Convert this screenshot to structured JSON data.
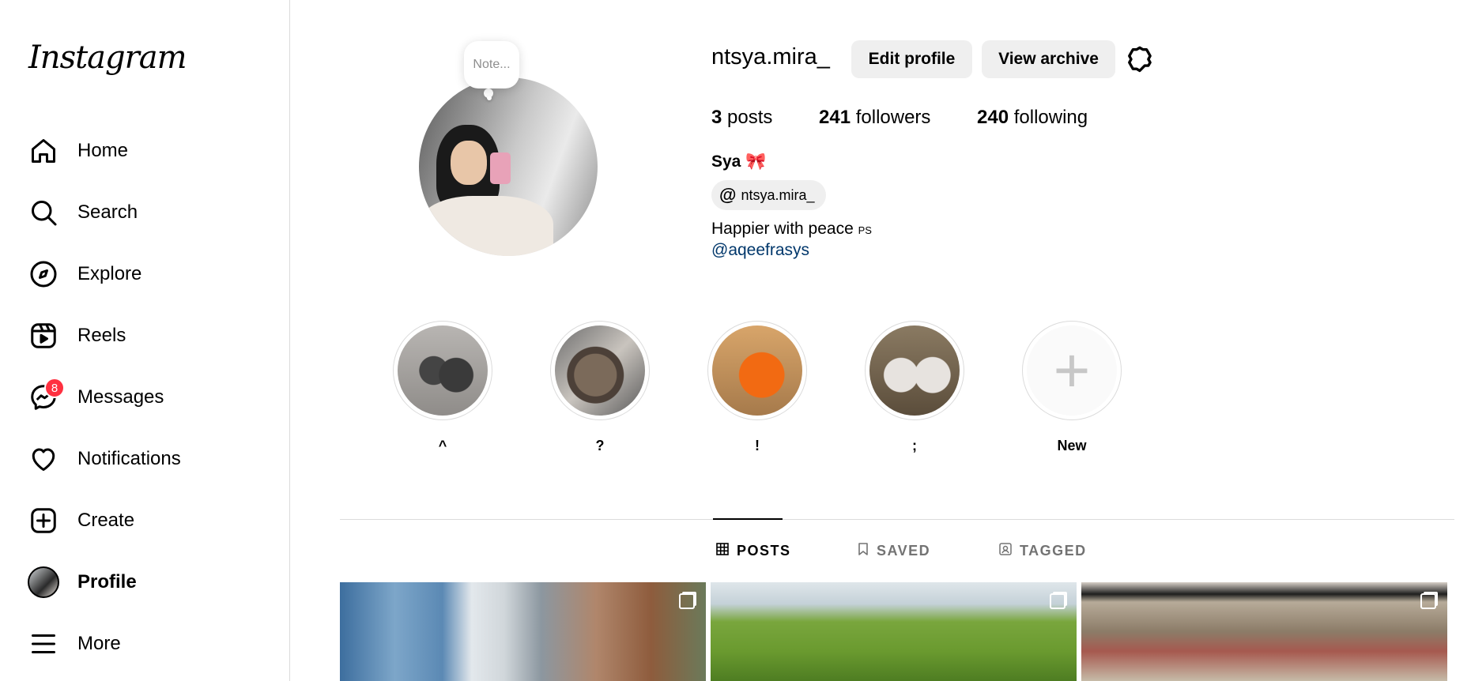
{
  "sidebar": {
    "logo": "Instagram",
    "items": [
      {
        "label": "Home",
        "icon": "home-icon"
      },
      {
        "label": "Search",
        "icon": "search-icon"
      },
      {
        "label": "Explore",
        "icon": "compass-icon"
      },
      {
        "label": "Reels",
        "icon": "reels-icon"
      },
      {
        "label": "Messages",
        "icon": "messenger-icon",
        "badge": "8"
      },
      {
        "label": "Notifications",
        "icon": "heart-icon"
      },
      {
        "label": "Create",
        "icon": "plus-square-icon"
      },
      {
        "label": "Profile",
        "icon": "avatar"
      },
      {
        "label": "More",
        "icon": "menu-icon"
      }
    ]
  },
  "profile": {
    "note": "Note...",
    "username": "ntsya.mira_",
    "edit_label": "Edit profile",
    "archive_label": "View archive",
    "stats": {
      "posts_count": "3",
      "posts_label": "posts",
      "followers_count": "241",
      "followers_label": "followers",
      "following_count": "240",
      "following_label": "following"
    },
    "full_name": "Sya",
    "name_emoji": "🎀",
    "threads_handle": "ntsya.mira_",
    "bio": "Happier with peace",
    "bio_suffix": "PS",
    "mention": "@aqeefrasys"
  },
  "highlights": [
    {
      "label": "^"
    },
    {
      "label": "?"
    },
    {
      "label": "!"
    },
    {
      "label": ";"
    },
    {
      "label": "New"
    }
  ],
  "tabs": [
    {
      "label": "POSTS",
      "active": true
    },
    {
      "label": "SAVED",
      "active": false
    },
    {
      "label": "TAGGED",
      "active": false
    }
  ],
  "colors": {
    "badge": "#ff3040",
    "link": "#00376b",
    "button_bg": "#efefef",
    "border": "#dbdbdb"
  }
}
